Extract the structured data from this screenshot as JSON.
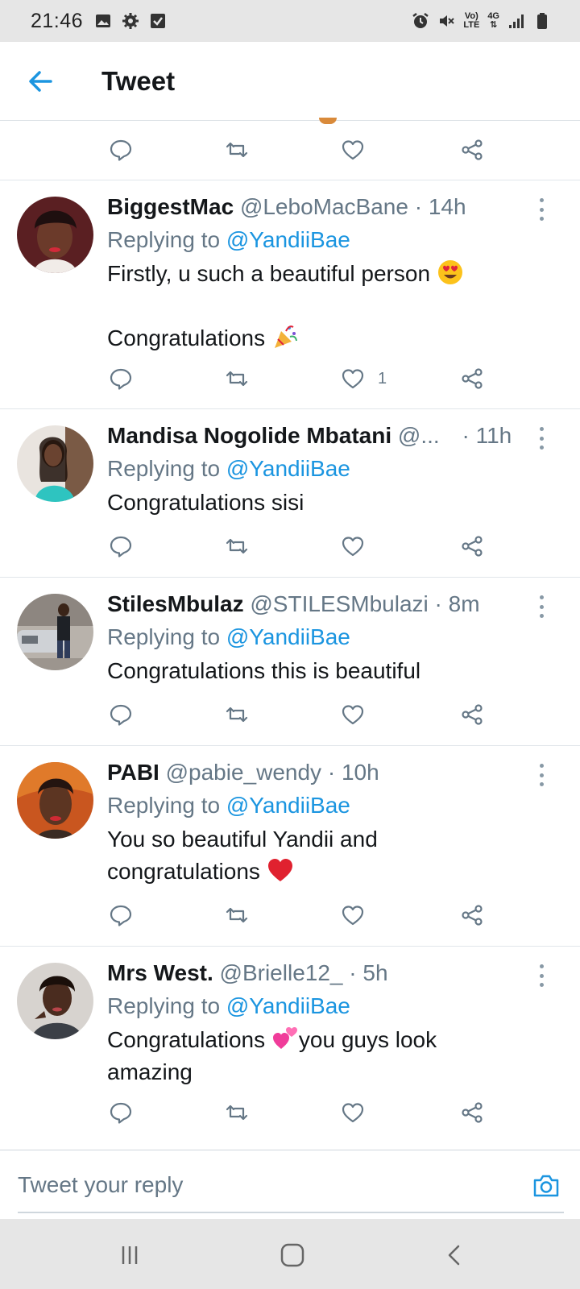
{
  "status_bar": {
    "time": "21:46",
    "left_icons": [
      "image-icon",
      "gear-icon",
      "checkbox-icon"
    ],
    "network_label_top": "Vo)",
    "network_label_bottom": "LTE",
    "data_label": "4G",
    "right_icons": [
      "alarm-icon",
      "mute-icon",
      "volte-icon",
      "4g-icon",
      "signal-icon",
      "battery-icon"
    ]
  },
  "header": {
    "title": "Tweet",
    "back_icon": "arrow-left-icon"
  },
  "replying_label": "Replying to ",
  "tweets": [
    {
      "name": "BiggestMac",
      "handle": "@LeboMacBane",
      "time": "· 14h",
      "mention": "@YandiiBae",
      "text_lines": [
        "Firstly, u such a beautiful person",
        "",
        "Congratulations"
      ],
      "emojis": [
        "heart-eyes-emoji",
        "party-popper-emoji"
      ],
      "like_count": "1"
    },
    {
      "name": "Mandisa Nogolide Mbatani",
      "handle": "@...",
      "time": "· 11h",
      "mention": "@YandiiBae",
      "text_lines": [
        "Congratulations sisi"
      ],
      "like_count": ""
    },
    {
      "name": "StilesMbulaz",
      "handle": "@STILESMbulazi",
      "time": "· 8m",
      "mention": "@YandiiBae",
      "text_lines": [
        "Congratulations this is beautiful"
      ],
      "like_count": ""
    },
    {
      "name": "PABI",
      "handle": "@pabie_wendy",
      "time": "· 10h",
      "mention": "@YandiiBae",
      "text_lines": [
        "You so beautiful Yandii and",
        "congratulations"
      ],
      "emojis": [
        "red-heart-emoji"
      ],
      "like_count": ""
    },
    {
      "name": "Mrs West.",
      "handle": "@Brielle12_",
      "time": "· 5h",
      "mention": "@YandiiBae",
      "text_lines": [
        "Congratulations",
        "you guys look",
        "amazing"
      ],
      "emojis": [
        "two-hearts-emoji"
      ],
      "like_count": ""
    }
  ],
  "reply_bar": {
    "placeholder": "Tweet your reply",
    "value": "",
    "camera_icon": "camera-icon"
  },
  "nav_bar": {
    "buttons": [
      "recent-apps-button",
      "home-button",
      "back-nav-button"
    ]
  },
  "colors": {
    "accent": "#1b95e0",
    "text_primary": "#14171a",
    "text_secondary": "#657786",
    "divider": "#e1e6ea",
    "system_bar": "#e6e6e6"
  }
}
